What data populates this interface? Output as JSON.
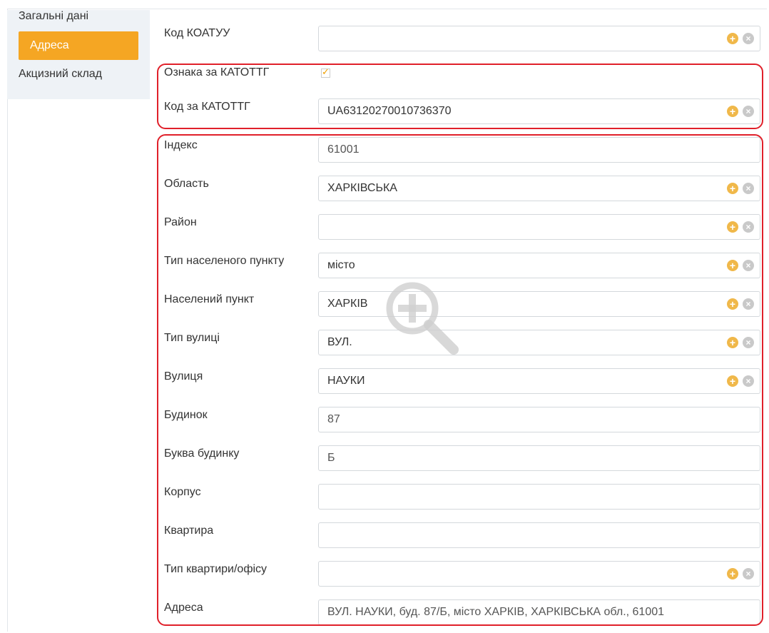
{
  "sidebar": {
    "items": [
      {
        "label": "Загальні дані",
        "active": false
      },
      {
        "label": "Адреса",
        "active": true
      },
      {
        "label": "Акцизний склад",
        "active": false
      }
    ]
  },
  "form": {
    "koatuu": {
      "label": "Код КОАТУУ",
      "value": ""
    },
    "katottg_flag": {
      "label": "Ознака за КАТОТТГ",
      "checked": true
    },
    "katottg_code": {
      "label": "Код за КАТОТТГ",
      "value": "UA63120270010736370"
    },
    "index": {
      "label": "Індекс",
      "value": "61001"
    },
    "region": {
      "label": "Область",
      "value": "ХАРКІВСЬКА"
    },
    "district": {
      "label": "Район",
      "value": ""
    },
    "settlement_type": {
      "label": "Тип населеного пункту",
      "value": "місто"
    },
    "settlement": {
      "label": "Населений пункт",
      "value": "ХАРКІВ"
    },
    "street_type": {
      "label": "Тип вулиці",
      "value": "ВУЛ."
    },
    "street": {
      "label": "Вулиця",
      "value": "НАУКИ"
    },
    "building": {
      "label": "Будинок",
      "value": "87"
    },
    "building_letter": {
      "label": "Буква будинку",
      "value": "Б"
    },
    "block": {
      "label": "Корпус",
      "value": ""
    },
    "apartment": {
      "label": "Квартира",
      "value": ""
    },
    "apartment_type": {
      "label": "Тип квартири/офісу",
      "value": ""
    },
    "address": {
      "label": "Адреса",
      "value": "ВУЛ. НАУКИ, буд. 87/Б, місто ХАРКІВ, ХАРКІВСЬКА обл., 61001"
    }
  },
  "icons": {
    "add": "plus-circle-icon",
    "clear": "x-circle-icon",
    "overlay": "zoom-in-icon"
  },
  "colors": {
    "accent": "#f5a623",
    "highlight": "#e0202a",
    "add_icon": "#f0b84a",
    "clear_icon": "#c9c9c9"
  }
}
